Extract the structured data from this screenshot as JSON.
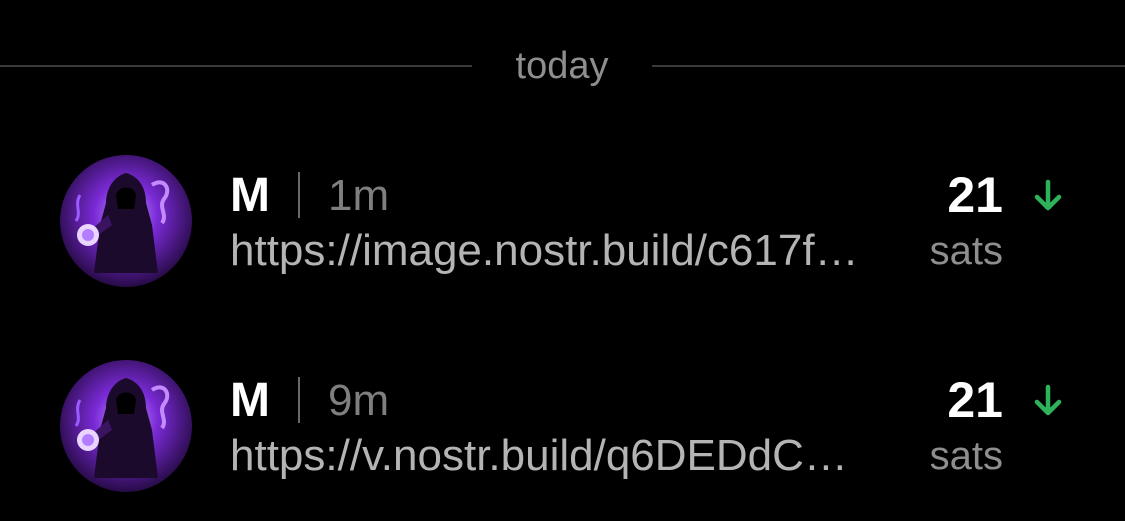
{
  "section": {
    "label": "today"
  },
  "zaps": [
    {
      "name": "M",
      "time": "1m",
      "content": "https://image.nostr.build/c617f…",
      "amount": "21",
      "unit": "sats",
      "direction_icon": "arrow-down-icon",
      "avatar_icon": "hooded-figure-avatar"
    },
    {
      "name": "M",
      "time": "9m",
      "content": "https://v.nostr.build/q6DEDdC…",
      "amount": "21",
      "unit": "sats",
      "direction_icon": "arrow-down-icon",
      "avatar_icon": "hooded-figure-avatar"
    }
  ],
  "colors": {
    "background": "#000000",
    "incoming_arrow": "#2fb35a",
    "avatar_accent": "#8a2be2"
  }
}
